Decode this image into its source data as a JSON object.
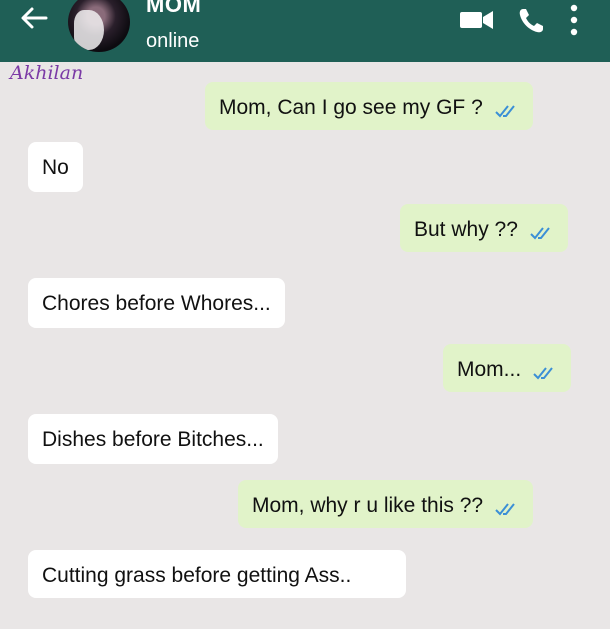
{
  "header": {
    "contact_name": "MOM",
    "status": "online",
    "accent_color": "#1f5f56"
  },
  "watermark": "Akhilan",
  "messages": [
    {
      "direction": "outgoing",
      "text": "Mom, Can I go see my GF ?",
      "read": true
    },
    {
      "direction": "incoming",
      "text": "No"
    },
    {
      "direction": "outgoing",
      "text": "But why ??",
      "read": true
    },
    {
      "direction": "incoming",
      "text": "Chores before Whores..."
    },
    {
      "direction": "outgoing",
      "text": "Mom...",
      "read": true
    },
    {
      "direction": "incoming",
      "text": "Dishes before Bitches..."
    },
    {
      "direction": "outgoing",
      "text": "Mom, why r u like this ??",
      "read": true
    },
    {
      "direction": "incoming",
      "text": "Cutting grass before getting Ass.."
    }
  ],
  "icons": [
    "back-arrow-icon",
    "avatar",
    "video-call-icon",
    "voice-call-icon",
    "more-options-icon",
    "double-check-icon"
  ]
}
